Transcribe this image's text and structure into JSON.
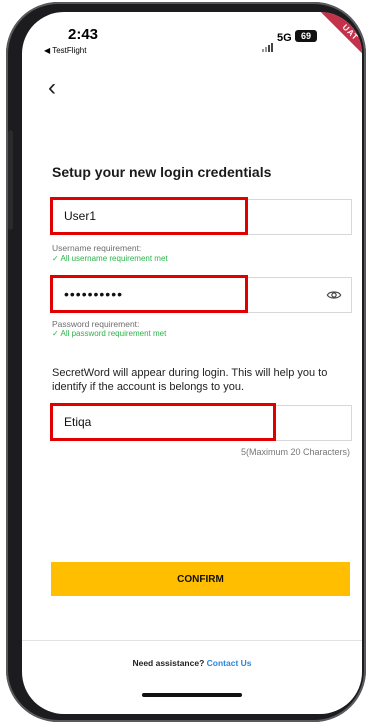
{
  "status_bar": {
    "time": "2:43",
    "back_app": "◀ TestFlight",
    "network": "5G",
    "battery": "69",
    "env_badge": "UAT"
  },
  "page": {
    "title": "Setup your new login credentials"
  },
  "username": {
    "value": "User1",
    "requirement_label": "Username requirement:",
    "requirement_status": "✓ All username requirement met"
  },
  "password": {
    "masked_value": "••••••••••",
    "requirement_label": "Password requirement:",
    "requirement_status": "✓ All password requirement met"
  },
  "secret_word": {
    "description": "SecretWord will appear during login. This will help you to identify if the account is belongs to you.",
    "value": "Etiqa",
    "counter": "5(Maximum 20 Characters)"
  },
  "actions": {
    "confirm_label": "CONFIRM"
  },
  "footer": {
    "assist_text": "Need assistance?",
    "contact_link": "Contact Us"
  },
  "colors": {
    "accent": "#ffbe00",
    "success": "#2cb34a",
    "link": "#2b86d9",
    "highlight": "#e00000"
  }
}
